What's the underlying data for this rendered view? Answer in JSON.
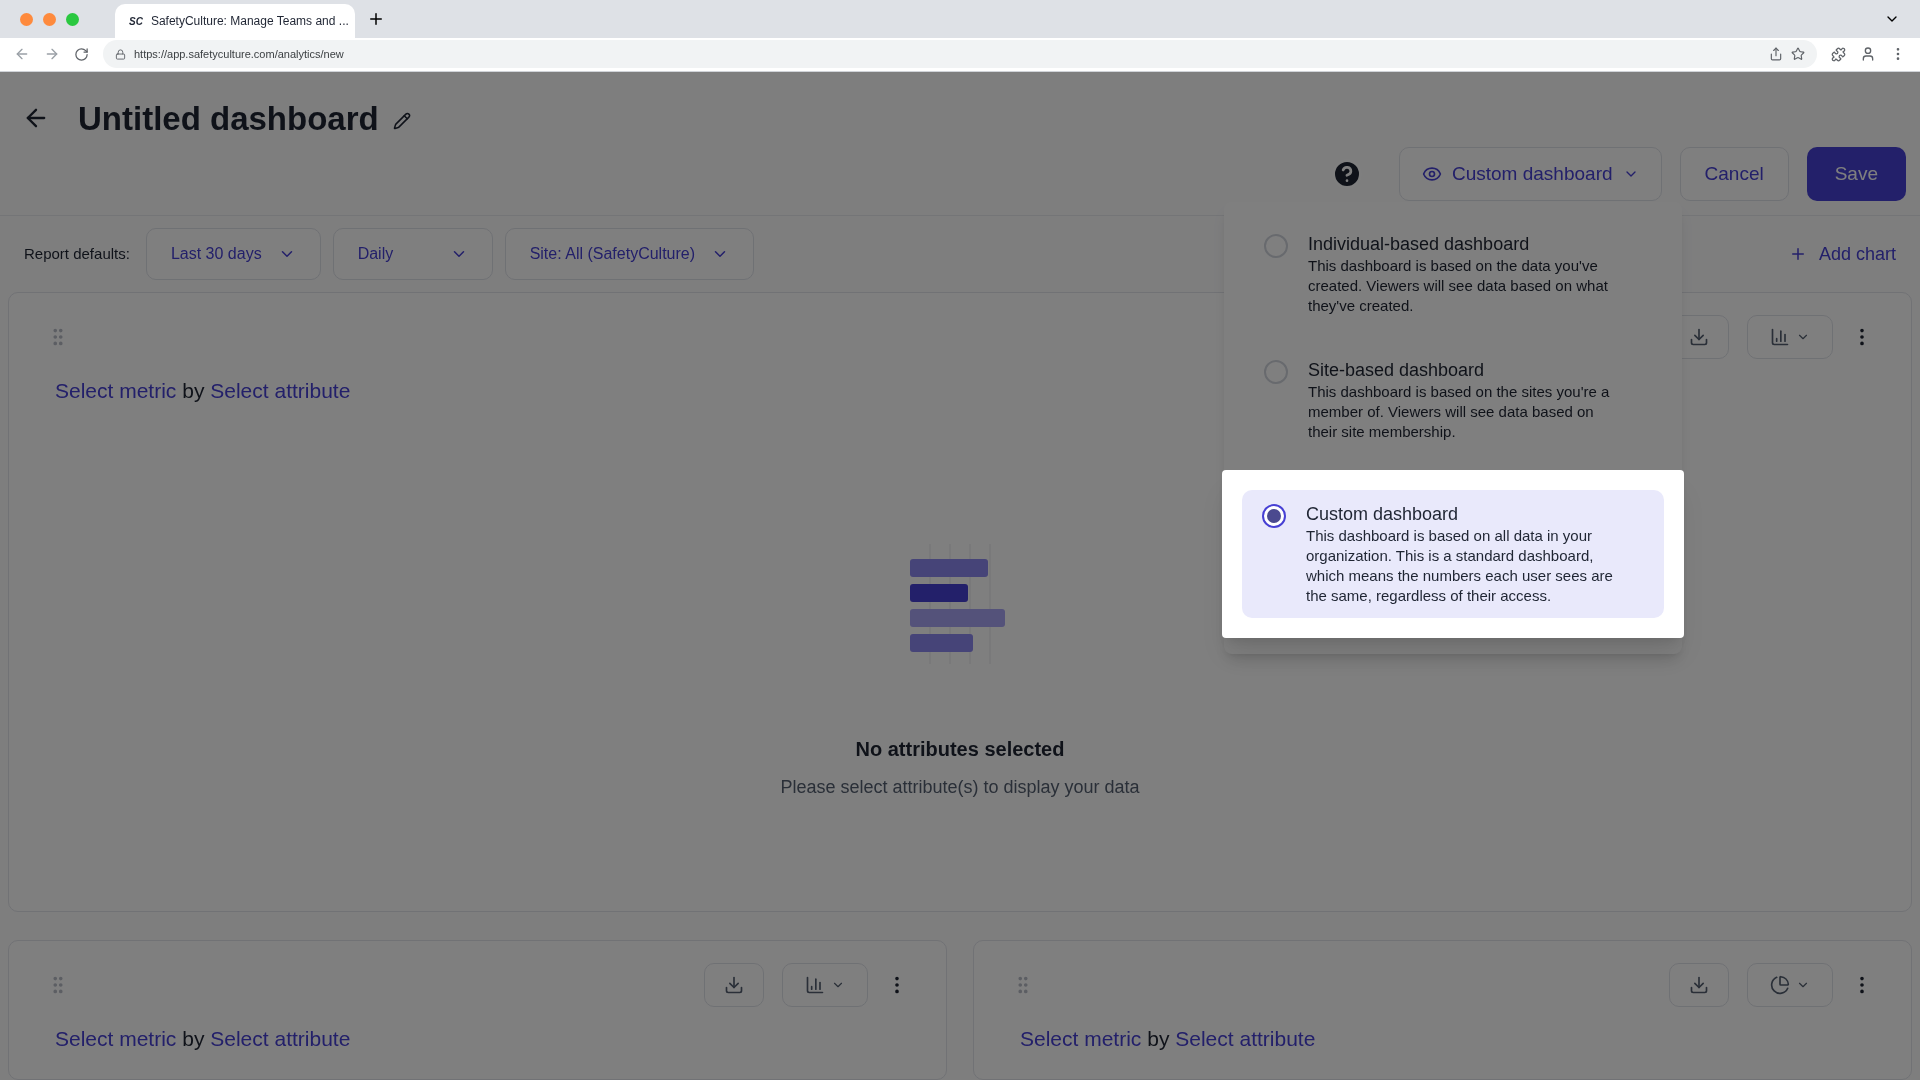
{
  "browser": {
    "favicon_text": "SC",
    "tab_title": "SafetyCulture: Manage Teams and ...",
    "url": "https://app.safetyculture.com/analytics/new"
  },
  "header": {
    "title": "Untitled dashboard",
    "view_selector": "Custom dashboard",
    "cancel": "Cancel",
    "save": "Save"
  },
  "report_defaults": {
    "label": "Report defaults:",
    "filters": [
      "Last 30 days",
      "Daily",
      "Site: All (SafetyCulture)"
    ],
    "add_chart": "Add chart"
  },
  "view_menu": {
    "options": [
      {
        "title": "Individual-based dashboard",
        "description": "This dashboard is based on the data you've created. Viewers will see data based on what they've created.",
        "selected": false
      },
      {
        "title": "Site-based dashboard",
        "description": "This dashboard is based on the sites you're a member of. Viewers will see data based on their site membership.",
        "selected": false
      },
      {
        "title": "Custom dashboard",
        "description": "This dashboard is based on all data in your organization. This is a standard dashboard, which means the numbers each user sees are the same, regardless of their access.",
        "selected": true
      }
    ]
  },
  "charts": [
    {
      "metric": "Select metric",
      "by": "by",
      "attribute": "Select attribute",
      "kind": "bar",
      "empty_title": "No attributes selected",
      "empty_text": "Please select attribute(s) to display your data"
    },
    {
      "metric": "Select metric",
      "by": "by",
      "attribute": "Select attribute",
      "kind": "bar"
    },
    {
      "metric": "Select metric",
      "by": "by",
      "attribute": "Select attribute",
      "kind": "pie"
    }
  ]
}
